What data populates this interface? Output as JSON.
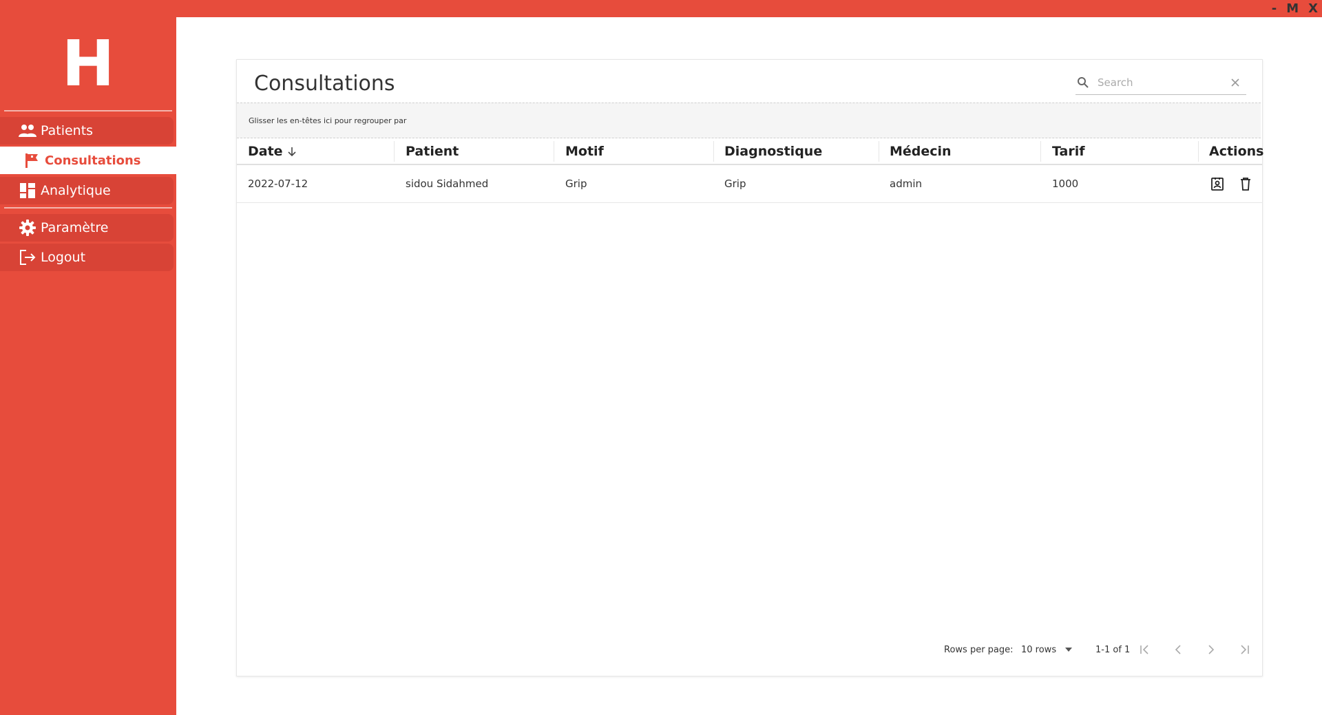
{
  "window_controls": {
    "minimize": "-",
    "maximize": "M",
    "close": "X"
  },
  "sidebar": {
    "logo": "H",
    "items": [
      {
        "label": "Patients",
        "icon": "people-icon"
      },
      {
        "label": "Consultations",
        "icon": "flag-icon",
        "active": true
      },
      {
        "label": "Analytique",
        "icon": "dashboard-icon"
      },
      {
        "label": "Paramètre",
        "icon": "gear-icon"
      },
      {
        "label": "Logout",
        "icon": "logout-icon"
      }
    ]
  },
  "page": {
    "title": "Consultations"
  },
  "search": {
    "placeholder": "Search",
    "value": ""
  },
  "group_hint": "Glisser les en-têtes ici pour regrouper par",
  "table": {
    "columns": [
      "Date",
      "Patient",
      "Motif",
      "Diagnostique",
      "Médecin",
      "Tarif",
      "Actions"
    ],
    "sort": {
      "column": "Date",
      "direction": "desc"
    },
    "rows": [
      {
        "date": "2022-07-12",
        "patient": "sidou Sidahmed",
        "motif": "Grip",
        "diagnostique": "Grip",
        "medecin": "admin",
        "tarif": "1000"
      }
    ]
  },
  "pagination": {
    "rows_per_page_label": "Rows per page:",
    "rows_per_page": "10 rows",
    "range": "1-1 of 1"
  },
  "colors": {
    "accent": "#e74c3c",
    "nav_item_bg": "#d84336"
  }
}
